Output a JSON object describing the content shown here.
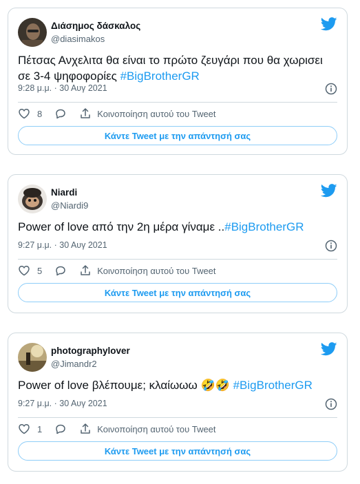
{
  "colors": {
    "accent": "#1d9bf0",
    "muted": "#536471",
    "border": "#cfd9de"
  },
  "icons": [
    "twitter-bird-icon",
    "info-icon",
    "heart-icon",
    "reply-bubble-icon",
    "share-upload-icon"
  ],
  "tweets": [
    {
      "name": "Διάσημος δάσκαλος",
      "handle": "@diasimakos",
      "text": "Πέτσας Ανχελιτα θα είναι το πρώτο ζευγάρι που θα χωρισει σε 3-4 ψηφοφορίες ",
      "hashtag": "#BigBrotherGR",
      "time": "9:28 μ.μ. · 30 Αυγ 2021",
      "likes": "8",
      "share_label": "Κοινοποίηση αυτού του Tweet",
      "reply_label": "Κάντε Tweet με την απάντησή σας"
    },
    {
      "name": "Niardi",
      "handle": "@Niardi9",
      "text": "Power of love από την 2η μέρα γίναμε ..",
      "hashtag": "#BigBrotherGR",
      "time": "9:27 μ.μ. · 30 Αυγ 2021",
      "likes": "5",
      "share_label": "Κοινοποίηση αυτού του Tweet",
      "reply_label": "Κάντε Tweet με την απάντησή σας"
    },
    {
      "name": "photographylover",
      "handle": "@Jimandr2",
      "text": "Power of love βλέπουμε; κλαίωωω 🤣🤣 ",
      "hashtag": "#BigBrotherGR",
      "time": "9:27 μ.μ. · 30 Αυγ 2021",
      "likes": "1",
      "share_label": "Κοινοποίηση αυτού του Tweet",
      "reply_label": "Κάντε Tweet με την απάντησή σας"
    }
  ]
}
